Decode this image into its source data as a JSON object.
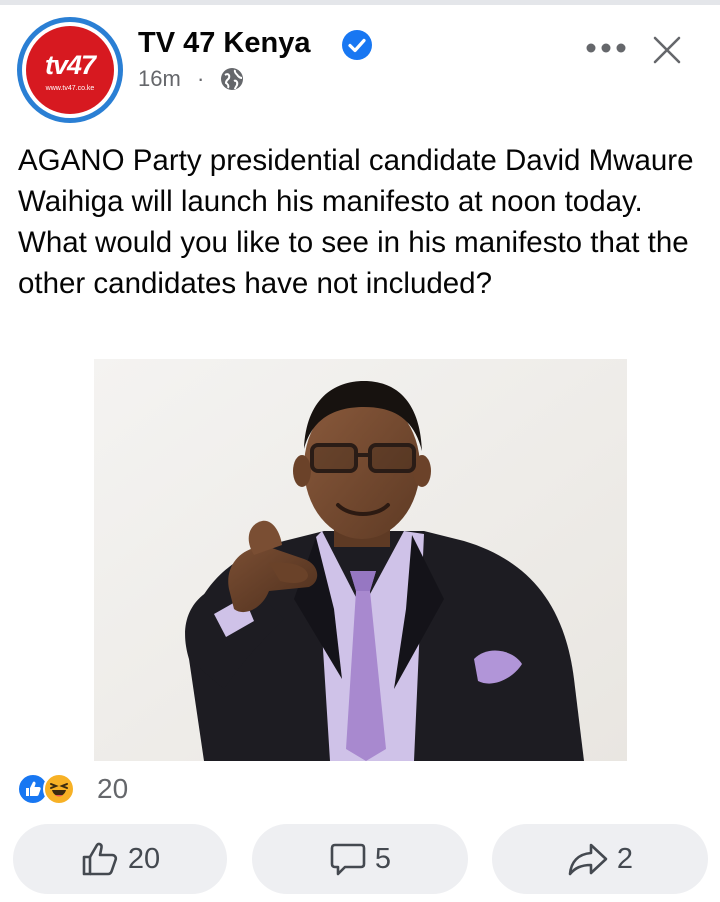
{
  "post": {
    "page_name": "TV 47 Kenya",
    "time": "16m",
    "separator": "·",
    "logo": {
      "text": "tv47",
      "url": "www.tv47.co.ke"
    },
    "text": "AGANO Party presidential candidate David Mwaure Waihiga will launch his manifesto at noon today. What would you like to see in his manifesto that the other candidates have not included?"
  },
  "reactions": {
    "count": "20",
    "types": [
      "like-icon",
      "haha-icon"
    ]
  },
  "actions": {
    "like_count": "20",
    "comment_count": "5",
    "share_count": "2"
  },
  "colors": {
    "brand_red": "#d71920",
    "facebook_blue": "#1877f2",
    "button_bg": "#eeeff2",
    "secondary_text": "#65676b"
  }
}
